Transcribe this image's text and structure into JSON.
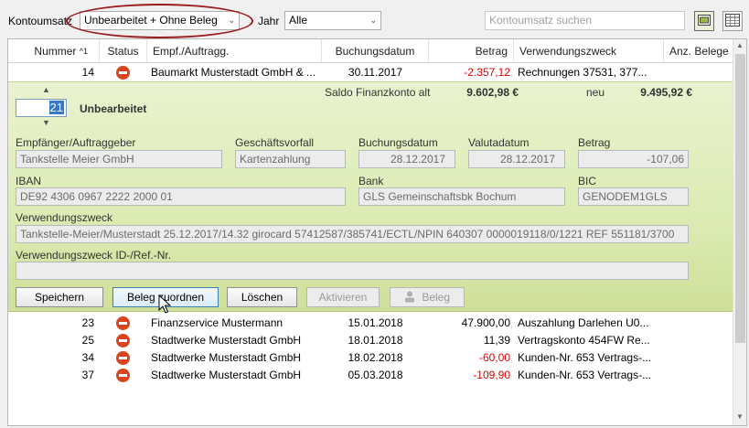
{
  "toolbar": {
    "kontoumsatz_label": "Kontoumsatz",
    "filter_value": "Unbearbeitet + Ohne Beleg",
    "jahr_label": "Jahr",
    "jahr_value": "Alle",
    "search_placeholder": "Kontoumsatz suchen"
  },
  "table": {
    "columns": [
      "Nummer",
      "Status",
      "Empf./Auftragg.",
      "Buchungsdatum",
      "Betrag",
      "Verwendungszweck",
      "Anz. Belege"
    ],
    "sort_indicator": "^1",
    "top_row": {
      "nummer": "14",
      "empf": "Baumarkt Musterstadt GmbH & ...",
      "datum": "30.11.2017",
      "betrag": "-2.357,12",
      "zweck": "Rechnungen 37531, 377..."
    },
    "rows": [
      {
        "nummer": "23",
        "empf": "Finanzservice Mustermann",
        "datum": "15.01.2018",
        "betrag": "47.900,00",
        "zweck": "Auszahlung Darlehen U0...",
        "negative": false
      },
      {
        "nummer": "25",
        "empf": "Stadtwerke Musterstadt GmbH",
        "datum": "18.01.2018",
        "betrag": "11,39",
        "zweck": "Vertragskonto 454FW Re...",
        "negative": false
      },
      {
        "nummer": "34",
        "empf": "Stadtwerke Musterstadt GmbH",
        "datum": "18.02.2018",
        "betrag": "-60,00",
        "zweck": "Kunden-Nr. 653 Vertrags-...",
        "negative": true
      },
      {
        "nummer": "37",
        "empf": "Stadtwerke Musterstadt GmbH",
        "datum": "05.03.2018",
        "betrag": "-109,90",
        "zweck": "Kunden-Nr. 653 Vertrags-...",
        "negative": true
      }
    ]
  },
  "detail": {
    "saldo_label": "Saldo Finanzkonto alt",
    "saldo_alt": "9.602,98 €",
    "neu_label": "neu",
    "saldo_neu": "9.495,92 €",
    "number_value": "21",
    "status_text": "Unbearbeitet",
    "empfaenger_label": "Empfänger/Auftraggeber",
    "empfaenger_value": "Tankstelle Meier GmbH",
    "geschaeftsvorfall_label": "Geschäftsvorfall",
    "geschaeftsvorfall_value": "Kartenzahlung",
    "buchungsdatum_label": "Buchungsdatum",
    "buchungsdatum_value": "28.12.2017",
    "valutadatum_label": "Valutadatum",
    "valutadatum_value": "28.12.2017",
    "betrag_label": "Betrag",
    "betrag_value": "-107,06",
    "iban_label": "IBAN",
    "iban_value": "DE92 4306 0967 2222 2000 01",
    "bank_label": "Bank",
    "bank_value": "GLS Gemeinschaftsbk Bochum",
    "bic_label": "BIC",
    "bic_value": "GENODEM1GLS",
    "verwendungszweck_label": "Verwendungszweck",
    "verwendungszweck_value": "Tankstelle-Meier/Musterstadt 25.12.2017/14.32 girocard 57412587/385741/ECTL/NPIN 640307 0000019118/0/1221 REF 551181/3700",
    "ref_label": "Verwendungszweck ID-/Ref.-Nr.",
    "ref_value": ""
  },
  "buttons": {
    "speichern": "Speichern",
    "beleg_zuordnen": "Beleg zuordnen",
    "loeschen": "Löschen",
    "aktivieren": "Aktivieren",
    "beleg": "Beleg"
  },
  "colors": {
    "negative": "#e00000",
    "status_stop": "#d9431e",
    "highlight_ellipse": "#9b1c1c",
    "detail_panel": "#dcebb3"
  }
}
